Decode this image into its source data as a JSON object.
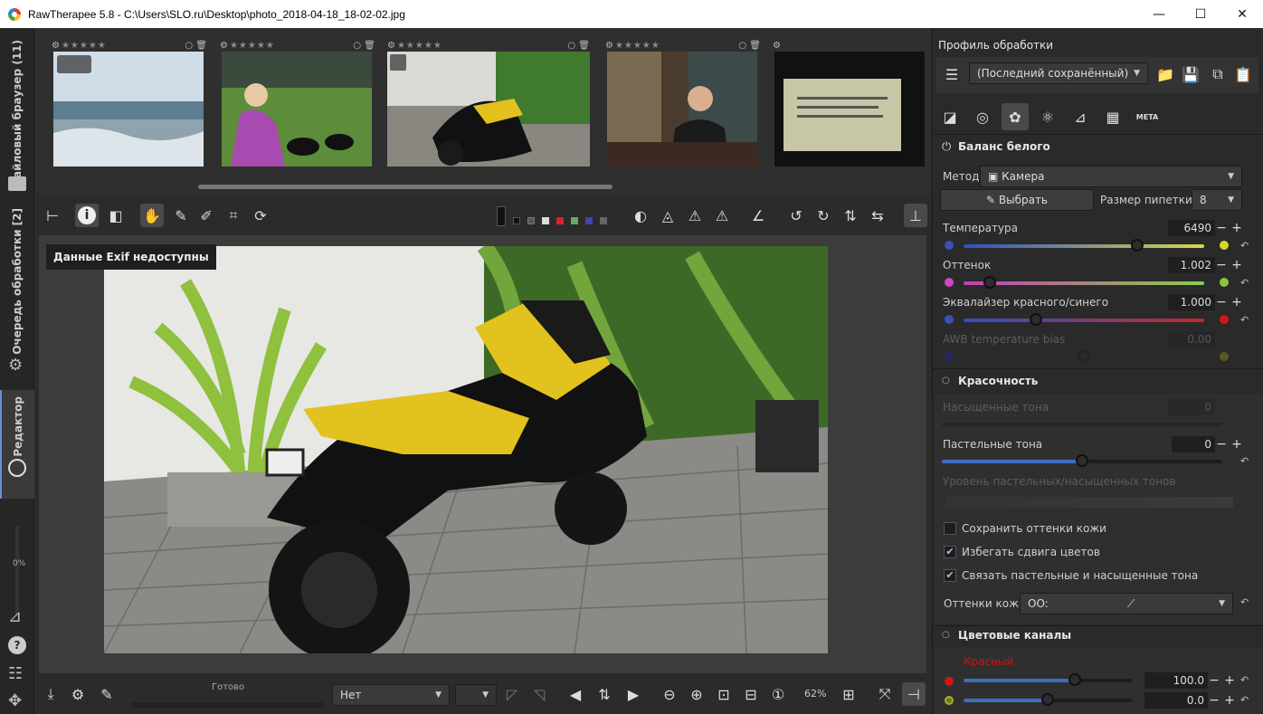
{
  "window": {
    "title": "RawTherapee 5.8 - C:\\Users\\SLO.ru\\Desktop\\photo_2018-04-18_18-02-02.jpg",
    "minimize": "—",
    "maximize": "☐",
    "close": "✕"
  },
  "sidebar": {
    "file_browser": "Файловый браузер (11)",
    "queue": "Очередь обработки [2]",
    "editor": "Редактор",
    "progress": "0%"
  },
  "filmstrip": {
    "stars": "★★★★★"
  },
  "viewer": {
    "exif_notice": "Данные Exif недоступны"
  },
  "bottom": {
    "status": "Готово",
    "snapshot_combo": "Нет",
    "zoom": "62%"
  },
  "panel": {
    "profile_title": "Профиль обработки",
    "profile_value": "(Последний сохранённый)",
    "white_balance": {
      "title": "Баланс белого",
      "method_label": "Метод:",
      "method_value": "Камера",
      "pick_button": "Выбрать",
      "pipette_label": "Размер пипетки:",
      "pipette_value": "8",
      "temperature_label": "Температура",
      "temperature_value": "6490",
      "temperature_fraction": 0.72,
      "tint_label": "Оттенок",
      "tint_value": "1.002",
      "tint_fraction": 0.11,
      "rb_label": "Эквалайзер красного/синего",
      "rb_value": "1.000",
      "rb_fraction": 0.3,
      "awb_label": "AWB temperature bias",
      "awb_value": "0.00",
      "awb_fraction": 0.5
    },
    "vibrance": {
      "title": "Красочность",
      "saturated_label": "Насыщенные тона",
      "saturated_value": "0",
      "pastel_label": "Пастельные тона",
      "pastel_value": "0",
      "pastel_fraction": 0.5,
      "threshold_label": "Уровень пастельных/насыщенных тонов",
      "protect_skin": "Сохранить оттенки кожи",
      "avoid_shift": "Избегать сдвига цветов",
      "link_tones": "Связать пастельные и насыщенные тона",
      "skin_tones_label": "Оттенки кожи:",
      "skin_tones_value": "OO:"
    },
    "channel_mixer": {
      "title": "Цветовые каналы",
      "red_label": "Красный",
      "red_value": "100.0",
      "red_fraction": 0.66,
      "green_value": "0.0",
      "green_fraction": 0.5
    }
  },
  "colors": {
    "accent": "#3d6ebf",
    "red": "#d01010",
    "bg": "#2b2b2b"
  }
}
